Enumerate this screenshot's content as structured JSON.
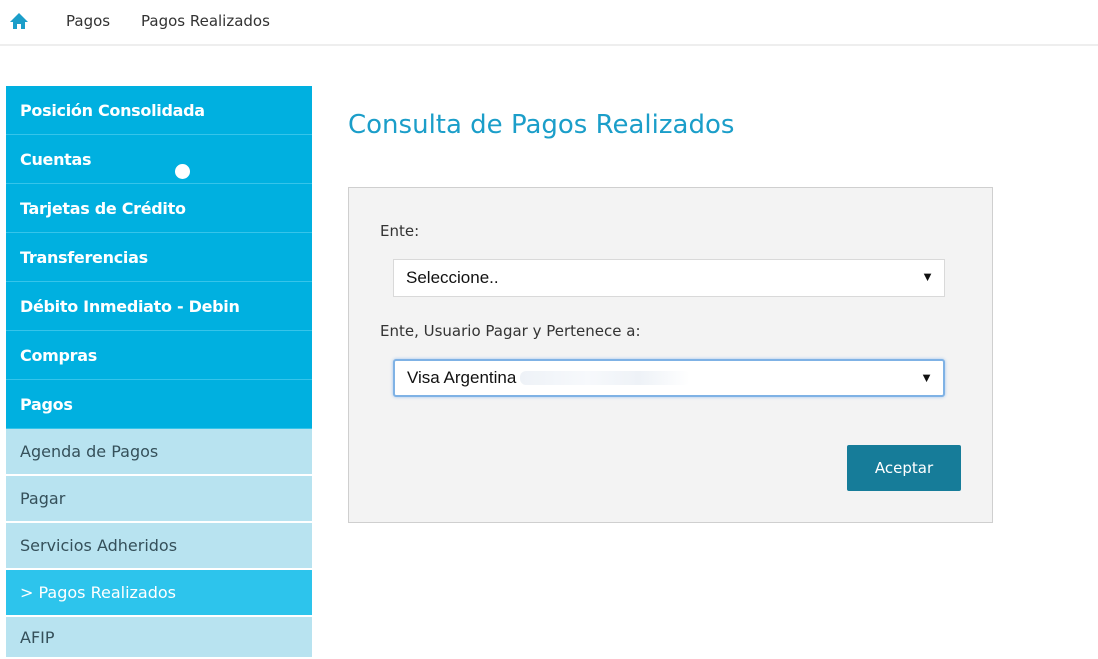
{
  "breadcrumb": {
    "icon": "home-icon",
    "items": [
      "Pagos",
      "Pagos Realizados"
    ]
  },
  "sidebar": {
    "main_items": [
      {
        "label": "Posición Consolidada"
      },
      {
        "label": "Cuentas"
      },
      {
        "label": "Tarjetas de Crédito"
      },
      {
        "label": "Transferencias"
      },
      {
        "label": "Débito Inmediato - Debin"
      },
      {
        "label": "Compras"
      },
      {
        "label": "Pagos"
      }
    ],
    "sub_items": [
      {
        "label": "Agenda de Pagos"
      },
      {
        "label": "Pagar"
      },
      {
        "label": "Servicios Adheridos"
      },
      {
        "label": ">  Pagos Realizados"
      },
      {
        "label": "AFIP"
      }
    ]
  },
  "main": {
    "title": "Consulta de Pagos Realizados",
    "form": {
      "ente_label": "Ente:",
      "ente_value": "Seleccione..",
      "usuario_label": "Ente, Usuario Pagar y Pertenece a:",
      "usuario_value": "Visa Argentina",
      "submit_label": "Aceptar"
    }
  },
  "colors": {
    "nav_main": "#00b0e0",
    "nav_sub": "#b8e3f0",
    "nav_active": "#2dc4ec",
    "title": "#1b9ec9",
    "button": "#167c99"
  }
}
